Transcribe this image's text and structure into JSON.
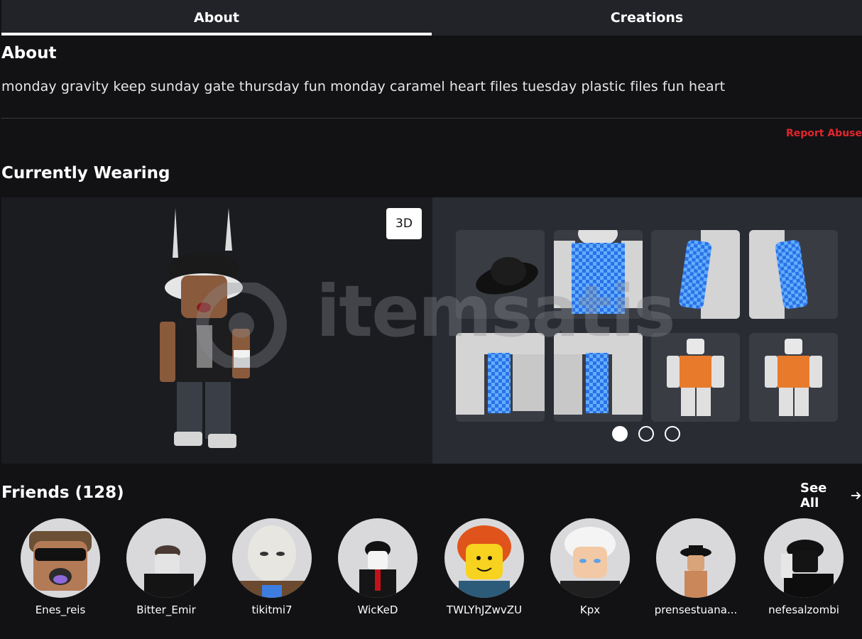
{
  "tabs": [
    {
      "label": "About",
      "active": true
    },
    {
      "label": "Creations",
      "active": false
    }
  ],
  "about": {
    "heading": "About",
    "text": "monday gravity keep sunday gate thursday fun monday caramel heart files tuesday plastic files fun heart",
    "report_label": "Report Abuse"
  },
  "wearing": {
    "heading": "Currently Wearing",
    "view_toggle_label": "3D",
    "items": [
      {
        "name": "hat-item-icon"
      },
      {
        "name": "checkered-shirt-item-icon"
      },
      {
        "name": "checkered-sleeve-item-icon"
      },
      {
        "name": "checkered-sleeve-back-item-icon"
      },
      {
        "name": "checkered-pants-left-item-icon"
      },
      {
        "name": "checkered-pants-right-item-icon"
      },
      {
        "name": "orange-outfit-item-icon"
      },
      {
        "name": "orange-outfit-back-item-icon"
      }
    ],
    "pages": 3,
    "current_page": 1,
    "watermark": "itemsatis"
  },
  "friends": {
    "heading": "Friends (128)",
    "see_all_label": "See All",
    "list": [
      {
        "name": "Enes_reis"
      },
      {
        "name": "Bitter_Emir"
      },
      {
        "name": "tikitmi7"
      },
      {
        "name": "WicKeD"
      },
      {
        "name": "TWLYhJZwvZU"
      },
      {
        "name": "Kpx"
      },
      {
        "name": "prensestuana..."
      },
      {
        "name": "nefesalzombi"
      }
    ]
  },
  "colors": {
    "background": "#121215",
    "tab_bar": "#222328",
    "report": "#e0262b",
    "items_panel": "#2a2c33",
    "checker_blue": "#2f6fe6"
  }
}
